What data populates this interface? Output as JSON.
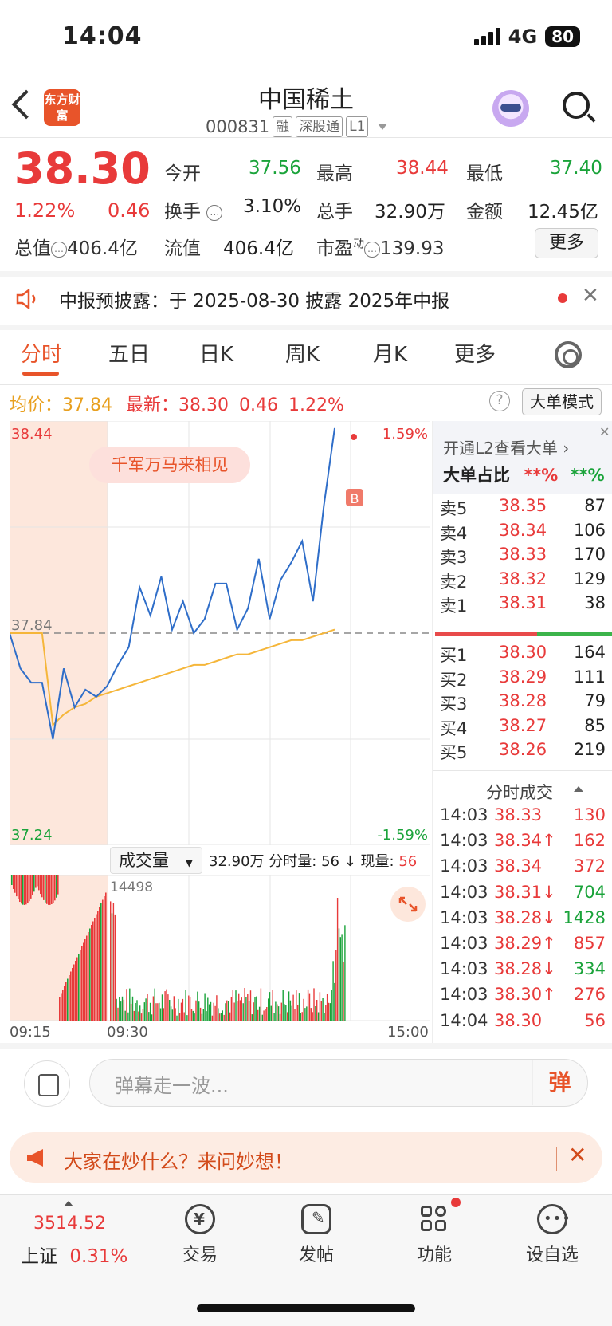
{
  "status": {
    "time": "14:04",
    "network": "4G",
    "battery": "80"
  },
  "header": {
    "logo_text": "东方财富",
    "stock_name": "中国稀土",
    "stock_code": "000831",
    "tags": [
      "融",
      "深股通",
      "L1"
    ]
  },
  "quote": {
    "price": "38.30",
    "change_pct": "1.22%",
    "change": "0.46",
    "open_label": "今开",
    "open": "37.56",
    "high_label": "最高",
    "high": "38.44",
    "low_label": "最低",
    "low": "37.40",
    "turnover_label": "换手",
    "turnover": "3.10%",
    "volume_label": "总手",
    "volume": "32.90万",
    "amount_label": "金额",
    "amount": "12.45亿",
    "mktcap_label": "总值",
    "mktcap": "406.4亿",
    "float_label": "流值",
    "float_cap": "406.4亿",
    "pe_label": "市盈",
    "pe_sup": "动",
    "pe": "139.93",
    "more_button": "更多"
  },
  "announcement": {
    "text": "中报预披露：于 2025-08-30 披露 2025年中报",
    "close": "✕"
  },
  "tabs": [
    {
      "label": "分时",
      "active": true
    },
    {
      "label": "五日"
    },
    {
      "label": "日K"
    },
    {
      "label": "周K"
    },
    {
      "label": "月K"
    },
    {
      "label": "更多"
    }
  ],
  "chart_header": {
    "avg_label": "均价：",
    "avg": "37.84",
    "latest_label": "最新：",
    "latest": "38.30",
    "latest_chg": "0.46",
    "latest_pct": "1.22%",
    "help": "?",
    "big_order_button": "大单模式"
  },
  "chart_data": {
    "type": "line",
    "y_top": "38.44",
    "y_mid": "37.84",
    "y_bottom": "37.24",
    "pct_top": "1.59%",
    "pct_bottom": "-1.59%",
    "ylim": [
      37.24,
      38.44
    ],
    "prev_close": 37.84,
    "banner": "千军万马来相见",
    "marker": "B",
    "series": [
      {
        "values": [
          37.84,
          37.74,
          37.7,
          37.7,
          37.54,
          37.74,
          37.63,
          37.68,
          37.66,
          37.69,
          37.75,
          37.8,
          37.97,
          37.89,
          38.0,
          37.85,
          37.93,
          37.84,
          37.88,
          37.98,
          37.98,
          37.85,
          37.91,
          38.05,
          37.88,
          37.99,
          38.04,
          38.1,
          37.93,
          38.2,
          38.42
        ],
        "color": "#2f6ec9"
      },
      {
        "values": [
          37.84,
          37.84,
          37.84,
          37.84,
          37.58,
          37.61,
          37.63,
          37.64,
          37.66,
          37.67,
          37.68,
          37.69,
          37.7,
          37.71,
          37.72,
          37.73,
          37.74,
          37.75,
          37.75,
          37.76,
          37.77,
          37.78,
          37.78,
          37.79,
          37.8,
          37.81,
          37.82,
          37.82,
          37.83,
          37.84,
          37.85
        ],
        "color": "#f5b63a"
      }
    ],
    "volume": {
      "label": "成交量",
      "total": "32.90万",
      "minute_vol_label": "分时量:",
      "minute_vol": "56",
      "now_vol_label": "现量:",
      "now_vol": "56",
      "max_label": "14498",
      "x_start": "09:15",
      "x_open": "09:30",
      "x_end": "15:00"
    }
  },
  "order_book": {
    "l2_link": "开通L2查看大单",
    "big_ratio_label": "大单占比",
    "big_ratio_red": "**%",
    "big_ratio_green": "**%",
    "asks": [
      {
        "label": "卖5",
        "price": "38.35",
        "vol": "87"
      },
      {
        "label": "卖4",
        "price": "38.34",
        "vol": "106"
      },
      {
        "label": "卖3",
        "price": "38.33",
        "vol": "170"
      },
      {
        "label": "卖2",
        "price": "38.32",
        "vol": "129"
      },
      {
        "label": "卖1",
        "price": "38.31",
        "vol": "38"
      }
    ],
    "bids": [
      {
        "label": "买1",
        "price": "38.30",
        "vol": "164"
      },
      {
        "label": "买2",
        "price": "38.29",
        "vol": "111"
      },
      {
        "label": "买3",
        "price": "38.28",
        "vol": "79"
      },
      {
        "label": "买4",
        "price": "38.27",
        "vol": "85"
      },
      {
        "label": "买5",
        "price": "38.26",
        "vol": "219"
      }
    ],
    "ticks_title": "分时成交",
    "ticks": [
      {
        "time": "14:03",
        "price": "38.33",
        "vol": "130",
        "dir": ""
      },
      {
        "time": "14:03",
        "price": "38.34↑",
        "vol": "162",
        "dir": "up"
      },
      {
        "time": "14:03",
        "price": "38.34",
        "vol": "372",
        "dir": ""
      },
      {
        "time": "14:03",
        "price": "38.31↓",
        "vol": "704",
        "dir": "down"
      },
      {
        "time": "14:03",
        "price": "38.28↓",
        "vol": "1428",
        "dir": "down"
      },
      {
        "time": "14:03",
        "price": "38.29↑",
        "vol": "857",
        "dir": "up"
      },
      {
        "time": "14:03",
        "price": "38.28↓",
        "vol": "334",
        "dir": "down"
      },
      {
        "time": "14:03",
        "price": "38.30↑",
        "vol": "276",
        "dir": "up"
      },
      {
        "time": "14:04",
        "price": "38.30",
        "vol": "56",
        "dir": ""
      }
    ]
  },
  "comment": {
    "placeholder": "弹幕走一波...",
    "button": "弹"
  },
  "ad": {
    "text": "大家在炒什么？来问妙想！",
    "close": "✕"
  },
  "bottom_nav": {
    "index_value": "3514.52",
    "index_name": "上证",
    "index_pct": "0.31%",
    "items": [
      {
        "label": "交易",
        "icon": "yen-exchange-icon"
      },
      {
        "label": "发帖",
        "icon": "edit-icon"
      },
      {
        "label": "功能",
        "icon": "grid-icon"
      },
      {
        "label": "设自选",
        "icon": "more-dots-icon"
      }
    ]
  }
}
